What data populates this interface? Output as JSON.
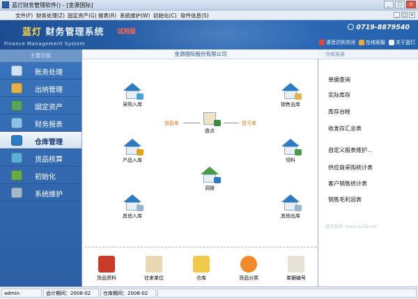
{
  "window": {
    "title": "蓝灯财务管理软件() - [金源国际]",
    "controls": [
      "_",
      "□",
      "×"
    ]
  },
  "menu": [
    "文件(F)",
    "财务处理(Z)",
    "固定资产(G)",
    "报表(R)",
    "系统维护(W)",
    "初始化(C)",
    "软件信息(S)"
  ],
  "banner": {
    "logo_brand": "蓝灯",
    "logo_system": "财务管理系统",
    "trial": "试用版",
    "subtitle": "Finance Management System",
    "phone": "0719-8879540",
    "tools": [
      "语音识别关闭",
      "在线客服",
      "关于蓝灯"
    ]
  },
  "sidebar": {
    "header": "主要功能",
    "items": [
      "账务处理",
      "出纳管理",
      "固定资产",
      "财务报表",
      "仓库管理",
      "货品核算",
      "初始化",
      "系统维护"
    ],
    "active_index": 4
  },
  "center": {
    "company": "金源国际股份有限公司",
    "nodes": {
      "purchase_in": "采购入库",
      "sales_out": "销售出库",
      "check": "盘点",
      "product_in": "产品入库",
      "material": "领料",
      "transfer": "调拨",
      "other_in": "其他入库",
      "other_out": "其他出库"
    },
    "flow_labels": {
      "surplus": "盘盈单",
      "deficit": "盘亏单"
    },
    "bottom_icons": [
      "货品资料",
      "往来单位",
      "仓库",
      "货品分类",
      "单据编号"
    ]
  },
  "right_panel": {
    "header": "仓库报表",
    "links": [
      "单据查询",
      "实际库存",
      "库存台帐",
      "收发存汇总表",
      "自定义报表维护...",
      "供应商采购统计表",
      "客户销售统计表",
      "销售毛利润表"
    ],
    "watermark": "蓝灯软件  www.sp16.net"
  },
  "status": {
    "user": "admin",
    "period_label": "会计期间：",
    "period_value": "2008-02",
    "warehouse_label": "仓库期间：",
    "warehouse_value": "2008-02"
  },
  "colors": {
    "banner": "#2e6bb7",
    "sidebar": "#3a74bc",
    "logo_brand": "#ffd84a",
    "trial": "#ff6a4a",
    "flow_label": "#d27a14"
  }
}
